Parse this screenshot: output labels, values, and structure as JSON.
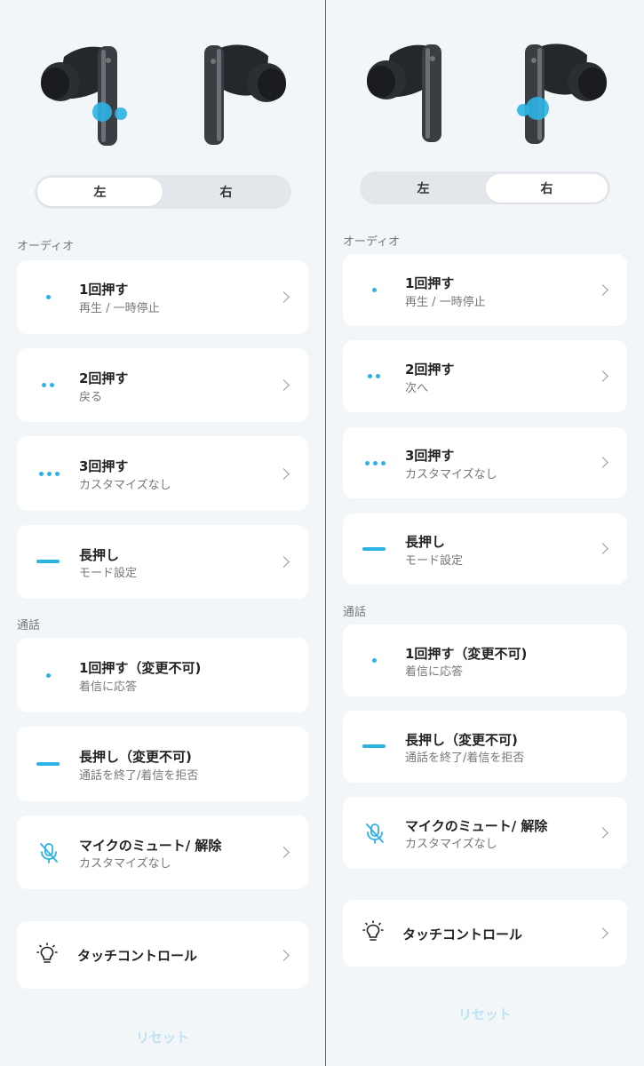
{
  "colors": {
    "accent": "#2cb2e4",
    "background": "#f3f6f9",
    "card": "#ffffff",
    "reset_text": "#bde2f2"
  },
  "left": {
    "tabs": [
      {
        "label": "左",
        "active": true
      },
      {
        "label": "右",
        "active": false
      }
    ],
    "audio_section": "オーディオ",
    "audio_items": [
      {
        "icon": "single-dot-icon",
        "title": "1回押す",
        "subtitle": "再生 / 一時停止"
      },
      {
        "icon": "double-dot-icon",
        "title": "2回押す",
        "subtitle": "戻る"
      },
      {
        "icon": "triple-dot-icon",
        "title": "3回押す",
        "subtitle": "カスタマイズなし"
      },
      {
        "icon": "long-press-icon",
        "title": "長押し",
        "subtitle": "モード設定"
      }
    ],
    "call_section": "通話",
    "call_items": [
      {
        "icon": "single-dot-icon",
        "title": "1回押す（変更不可)",
        "subtitle": "着信に応答"
      },
      {
        "icon": "long-press-icon",
        "title": "長押し（変更不可)",
        "subtitle": "通話を終了/着信を拒否"
      },
      {
        "icon": "mic-mute-icon",
        "title": "マイクのミュート/ 解除",
        "subtitle": "カスタマイズなし"
      }
    ],
    "touch_control": "タッチコントロール",
    "reset": "リセット"
  },
  "right": {
    "tabs": [
      {
        "label": "左",
        "active": false
      },
      {
        "label": "右",
        "active": true
      }
    ],
    "audio_section": "オーディオ",
    "audio_items": [
      {
        "icon": "single-dot-icon",
        "title": "1回押す",
        "subtitle": "再生 / 一時停止"
      },
      {
        "icon": "double-dot-icon",
        "title": "2回押す",
        "subtitle": "次へ"
      },
      {
        "icon": "triple-dot-icon",
        "title": "3回押す",
        "subtitle": "カスタマイズなし"
      },
      {
        "icon": "long-press-icon",
        "title": "長押し",
        "subtitle": "モード設定"
      }
    ],
    "call_section": "通話",
    "call_items": [
      {
        "icon": "single-dot-icon",
        "title": "1回押す（変更不可)",
        "subtitle": "着信に応答"
      },
      {
        "icon": "long-press-icon",
        "title": "長押し（変更不可)",
        "subtitle": "通話を終了/着信を拒否"
      },
      {
        "icon": "mic-mute-icon",
        "title": "マイクのミュート/ 解除",
        "subtitle": "カスタマイズなし"
      }
    ],
    "touch_control": "タッチコントロール",
    "reset": "リセット"
  }
}
